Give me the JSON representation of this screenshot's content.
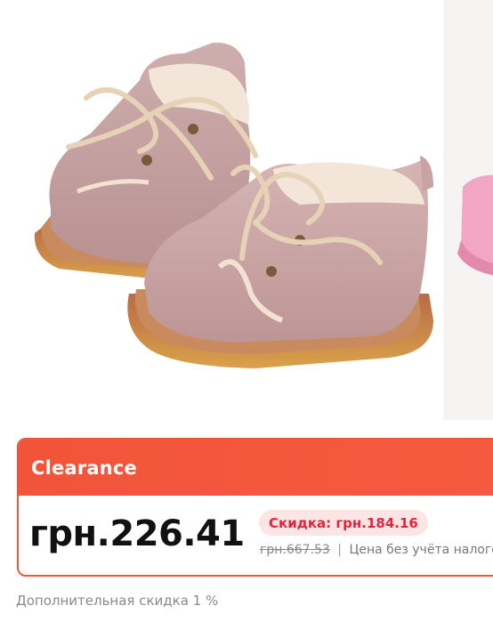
{
  "gallery": {
    "main_image_alt": "pink suede baby boots",
    "next_image_alt": "pink baby shoe"
  },
  "promo": {
    "title": "Clearance",
    "price": "грн.226.41",
    "discount_badge": "Скидка: грн.184.16",
    "old_price": "грн.667.53",
    "separator": "|",
    "tax_note": "Цена без учёта налогов"
  },
  "extra_discount": "Дополнительная скидка 1 %",
  "colors": {
    "accent": "#f2543a",
    "badge_bg": "#fde5e5",
    "badge_text": "#e3243b",
    "price_text": "#111111",
    "muted_text": "#8a8a8a"
  }
}
